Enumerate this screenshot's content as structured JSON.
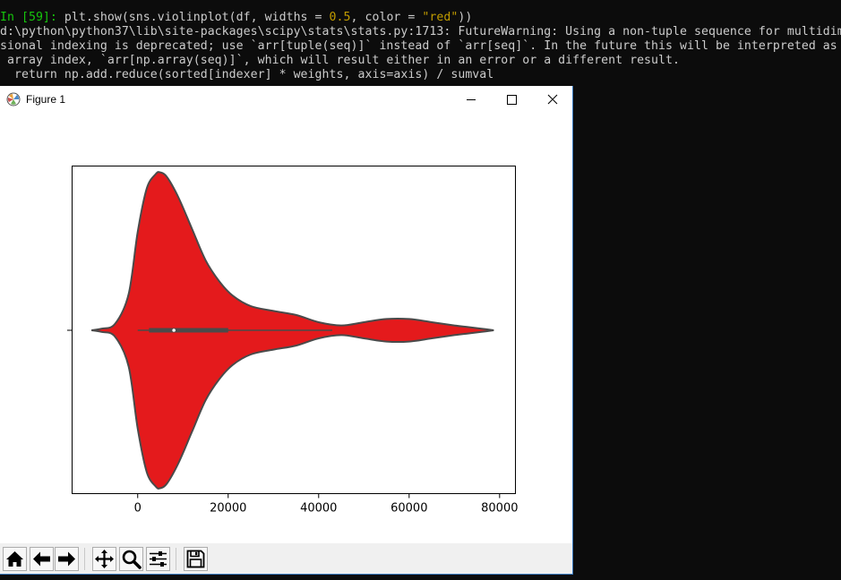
{
  "console": {
    "prompt": "In [59]: ",
    "cmd_a": "plt.show(sns.violinplot(df, widths = ",
    "cmd_num": "0.5",
    "cmd_b": ", color = ",
    "cmd_str": "\"red\"",
    "cmd_c": "))",
    "warn1": "d:\\python\\python37\\lib\\site-packages\\scipy\\stats\\stats.py:1713: FutureWarning: Using a non-tuple sequence for multidim",
    "warn2": "sional indexing is deprecated; use `arr[tuple(seq)]` instead of `arr[seq]`. In the future this will be interpreted as",
    "warn3": " array index, `arr[np.array(seq)]`, which will result either in an error or a different result.",
    "warn4": "  return np.add.reduce(sorted[indexer] * weights, axis=axis) / sumval"
  },
  "window": {
    "title": "Figure 1"
  },
  "colors": {
    "violin_fill": "#e41a1c",
    "violin_edge": "#4a4a4a",
    "console_bg": "#0c0c0c",
    "prompt_green": "#16c60c",
    "number_yellow": "#c19c00"
  },
  "toolbar": {
    "buttons": [
      "home-icon",
      "back-arrow-icon",
      "forward-arrow-icon",
      "pan-icon",
      "zoom-icon",
      "configure-subplots-icon",
      "save-icon"
    ]
  },
  "chart_data": {
    "type": "violin",
    "title": "",
    "xlabel": "",
    "ylabel": "",
    "xlim": [
      -14500,
      83500
    ],
    "xticks": [
      0,
      20000,
      40000,
      60000,
      80000
    ],
    "xtick_labels": [
      "0",
      "20000",
      "40000",
      "60000",
      "80000"
    ],
    "violin_color": "red",
    "violin_width": 0.5,
    "density_profile": {
      "x": [
        -10200,
        -8000,
        -5000,
        -2000,
        0,
        2000,
        4000,
        5000,
        6500,
        9000,
        12000,
        15000,
        18000,
        21000,
        25000,
        30000,
        35000,
        40000,
        45000,
        50000,
        55000,
        60000,
        65000,
        70000,
        73000,
        76000,
        78700
      ],
      "half_width": [
        0,
        2,
        8,
        45,
        122,
        176,
        194,
        196,
        190,
        165,
        126,
        87,
        61,
        43,
        30,
        24,
        19,
        10,
        6,
        10,
        14,
        14,
        10,
        6,
        4,
        2,
        0
      ]
    },
    "box": {
      "whisker_low": 0,
      "q1": 2500,
      "median": 8000,
      "q3": 20000,
      "whisker_high": 43000
    }
  }
}
